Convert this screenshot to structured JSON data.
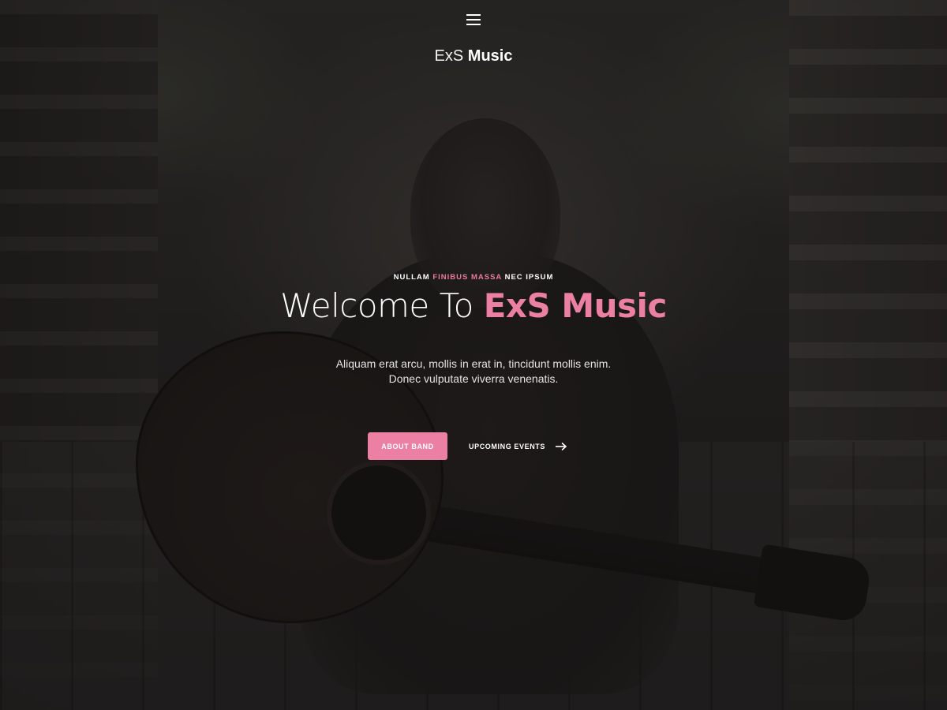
{
  "header": {
    "menu_icon": "hamburger-menu-icon",
    "logo_light": "ExS",
    "logo_bold": "Music"
  },
  "hero": {
    "kicker_part1": "NULLAM ",
    "kicker_accent": "FINIBUS MASSA",
    "kicker_part2": " NEC IPSUM",
    "headline_light": "Welcome To ",
    "headline_accent": "ExS Music",
    "subtext_line1": "Aliquam erat arcu, mollis in erat in, tincidunt mollis enim.",
    "subtext_line2": "Donec vulputate viverra venenatis.",
    "primary_button": "ABOUT BAND",
    "secondary_link": "UPCOMING EVENTS",
    "arrow_icon": "arrow-right-icon"
  },
  "colors": {
    "accent": "#ec7fa4",
    "overlay": "#121011",
    "text": "#ffffff"
  }
}
